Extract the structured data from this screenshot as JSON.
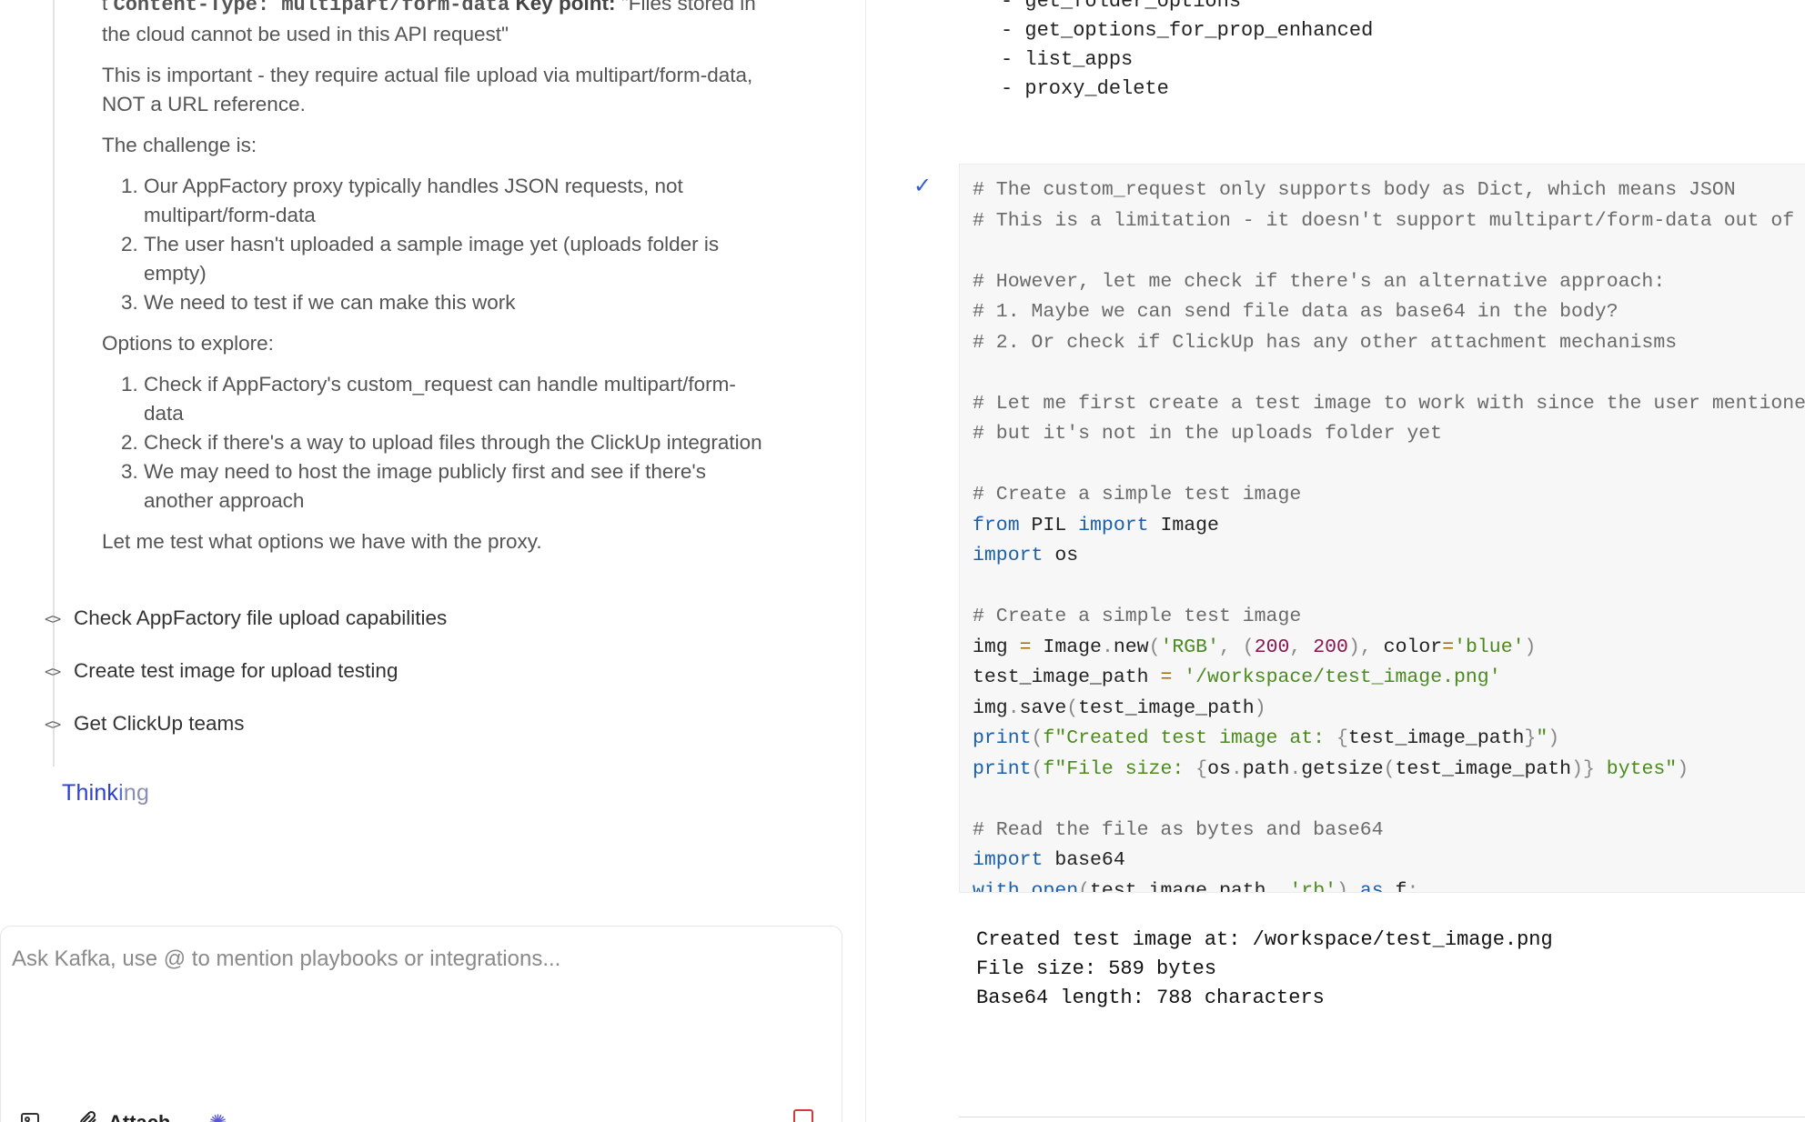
{
  "chat": {
    "thinking_paragraphs": {
      "top_line_code": "Content-Type: multipart/form-data",
      "top_line_keypoint_label": "Key point:",
      "top_line_rest": "\"Files stored in the cloud cannot be used in this API request\"",
      "important": "This is important - they require actual file upload via multipart/form-data, NOT a URL reference.",
      "challenge_heading": "The challenge is:",
      "challenges": [
        "Our AppFactory proxy typically handles JSON requests, not multipart/form-data",
        "The user hasn't uploaded a sample image yet (uploads folder is empty)",
        "We need to test if we can make this work"
      ],
      "options_heading": "Options to explore:",
      "options": [
        "Check if AppFactory's custom_request can handle multipart/form-data",
        "Check if there's a way to upload files through the ClickUp integration",
        "We may need to host the image publicly first and see if there's another approach"
      ],
      "closing": "Let me test what options we have with the proxy."
    },
    "tool_calls": [
      "Check AppFactory file upload capabilities",
      "Create test image for upload testing",
      "Get ClickUp teams"
    ],
    "status": {
      "part1": "Think",
      "part2": "i",
      "part3": "ng"
    }
  },
  "composer": {
    "placeholder": "Ask Kafka, use @ to mention playbooks or integrations...",
    "attach_label": "Attach",
    "icons": [
      "image-icon",
      "paperclip-icon",
      "sparkle-icon",
      "stop-icon"
    ]
  },
  "right": {
    "prev_list": [
      "- get_folder_options",
      "- get_options_for_prop_enhanced",
      "- list_apps",
      "- proxy_delete"
    ],
    "output_lines": [
      "Created test image at: /workspace/test_image.png",
      "File size: 589 bytes",
      "Base64 length: 788 characters"
    ]
  },
  "colors": {
    "accent": "#2b3fd6",
    "check": "#2d5fd3",
    "stop": "#d53a3a"
  }
}
